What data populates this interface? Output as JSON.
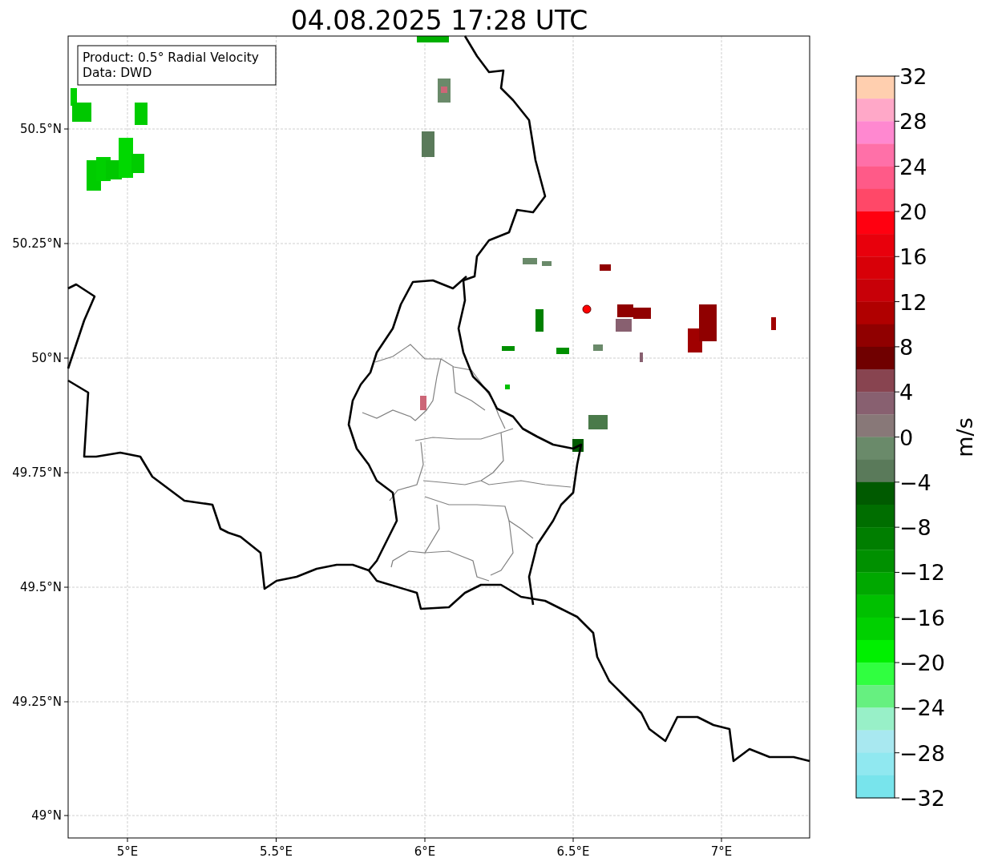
{
  "title": "04.08.2025 17:28 UTC",
  "info_box": {
    "lines": [
      "Product: 0.5° Radial Velocity",
      "Data: DWD"
    ]
  },
  "map": {
    "x_ticks": [
      "5°E",
      "5.5°E",
      "6°E",
      "6.5°E",
      "7°E"
    ],
    "y_ticks": [
      "50.5°N",
      "50.25°N",
      "50°N",
      "49.75°N",
      "49.5°N",
      "49.25°N",
      "49°N"
    ]
  },
  "colorbar": {
    "label": "m/s",
    "ticks": [
      "32",
      "28",
      "24",
      "20",
      "16",
      "12",
      "8",
      "4",
      "0",
      "−4",
      "−8",
      "−12",
      "−16",
      "−20",
      "−24",
      "−28",
      "−32"
    ],
    "bands": [
      {
        "color": "#ffcfaf"
      },
      {
        "color": "#ffa8c8"
      },
      {
        "color": "#ff88d0"
      },
      {
        "color": "#ff70a8"
      },
      {
        "color": "#ff5a88"
      },
      {
        "color": "#ff4868"
      },
      {
        "color": "#ff0010"
      },
      {
        "color": "#e8000c"
      },
      {
        "color": "#d80008"
      },
      {
        "color": "#c80008"
      },
      {
        "color": "#b00000"
      },
      {
        "color": "#900000"
      },
      {
        "color": "#700000"
      },
      {
        "color": "#884450"
      },
      {
        "color": "#886070"
      },
      {
        "color": "#887878"
      },
      {
        "color": "#6a8a6a"
      },
      {
        "color": "#5a7a5a"
      },
      {
        "color": "#005a00"
      },
      {
        "color": "#006e00"
      },
      {
        "color": "#007e00"
      },
      {
        "color": "#009000"
      },
      {
        "color": "#00a800"
      },
      {
        "color": "#00c000"
      },
      {
        "color": "#00d000"
      },
      {
        "color": "#00f000"
      },
      {
        "color": "#30ff40"
      },
      {
        "color": "#66f080"
      },
      {
        "color": "#98f0c8"
      },
      {
        "color": "#a8e8f0"
      },
      {
        "color": "#90e8f0"
      },
      {
        "color": "#78e4ec"
      }
    ]
  }
}
